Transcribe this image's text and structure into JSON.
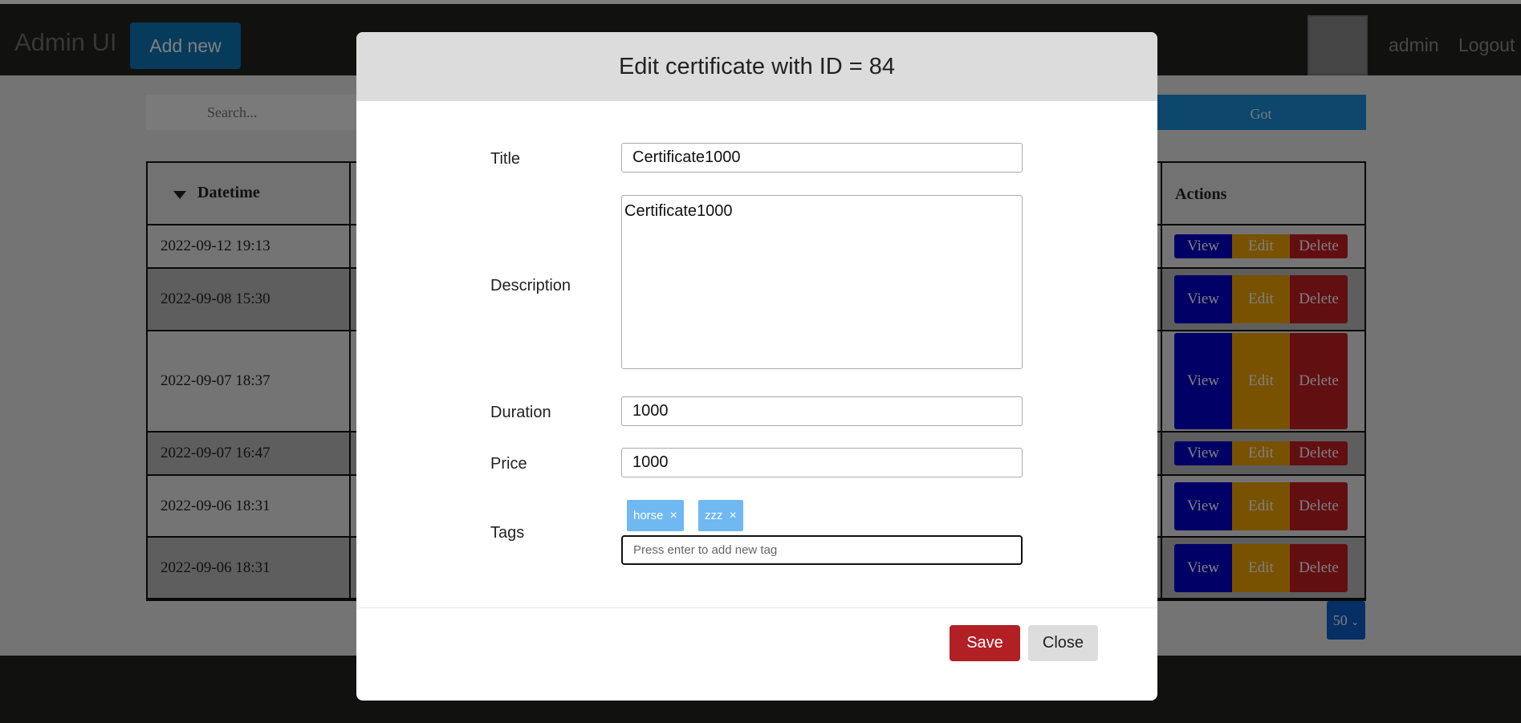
{
  "nav": {
    "brand": "Admin UI",
    "add_new": "Add new",
    "user": "admin",
    "logout": "Logout"
  },
  "search": {
    "placeholder": "Search...",
    "go": "Got"
  },
  "table": {
    "headers": {
      "datetime": "Datetime",
      "actions": "Actions"
    },
    "actions": {
      "view": "View",
      "edit": "Edit",
      "delete": "Delete"
    },
    "rows": [
      {
        "datetime": "2022-09-12 19:13"
      },
      {
        "datetime": "2022-09-08 15:30"
      },
      {
        "datetime": "2022-09-07 18:37"
      },
      {
        "datetime": "2022-09-07 16:47"
      },
      {
        "datetime": "2022-09-06 18:31"
      },
      {
        "datetime": "2022-09-06 18:31"
      }
    ]
  },
  "pagination": {
    "per_page": "50"
  },
  "modal": {
    "title": "Edit certificate with ID = 84",
    "labels": {
      "title": "Title",
      "description": "Description",
      "duration": "Duration",
      "price": "Price",
      "tags": "Tags"
    },
    "values": {
      "title": "Certificate1000",
      "description": "Certificate1000",
      "duration": "1000",
      "price": "1000"
    },
    "tags": [
      {
        "label": "horse",
        "remove": "×"
      },
      {
        "label": "zzz",
        "remove": "×"
      }
    ],
    "tag_placeholder": "Press enter to add new tag",
    "save": "Save",
    "close": "Close"
  },
  "colors": {
    "navbar": "#222220",
    "primary_blue": "#0d76b8",
    "view": "#0000cc",
    "edit": "#f0a400",
    "delete": "#c41e24",
    "save": "#b21f24",
    "tag": "#6fb8f2"
  },
  "icons": {
    "sort": "caret-down-icon",
    "tag_remove": "close-icon",
    "per_page": "chevron-down-icon"
  }
}
